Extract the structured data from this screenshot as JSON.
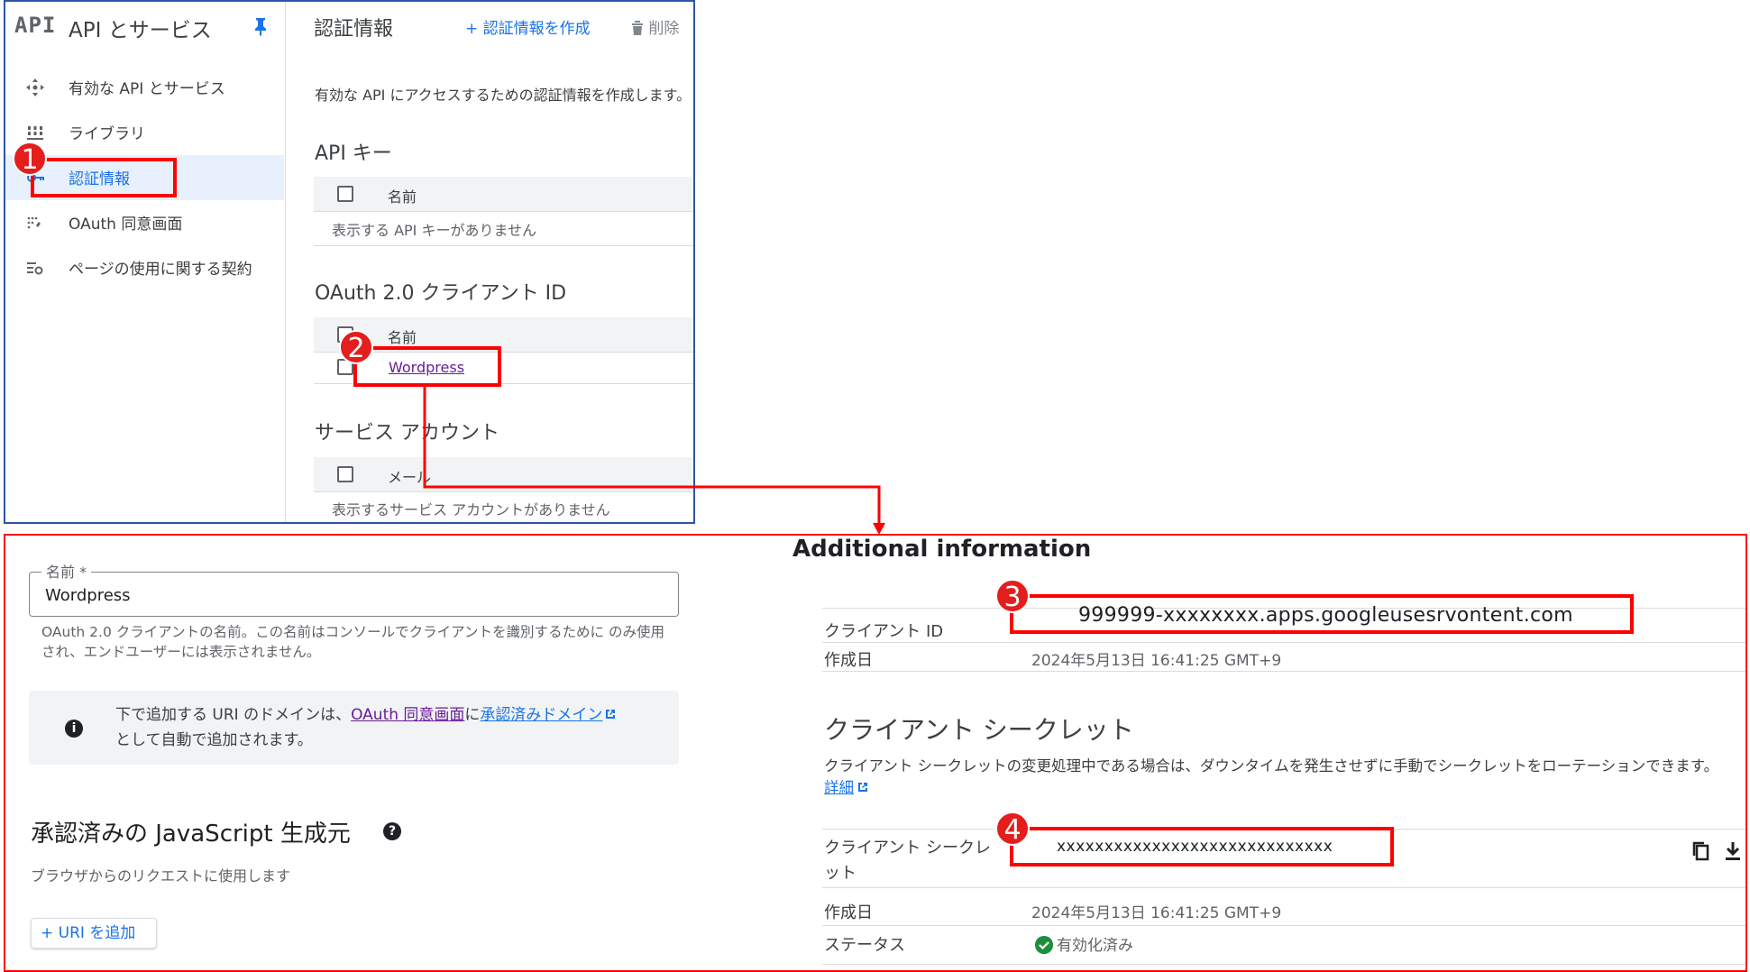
{
  "sidebar": {
    "logo": "API",
    "title": "API とサービス",
    "items": [
      {
        "label": "有効な API とサービス",
        "icon": "crosshair-icon"
      },
      {
        "label": "ライブラリ",
        "icon": "library-icon"
      },
      {
        "label": "認証情報",
        "icon": "key-icon",
        "active": true
      },
      {
        "label": "OAuth 同意画面",
        "icon": "consent-icon"
      },
      {
        "label": "ページの使用に関する契約",
        "icon": "settings-list-icon"
      }
    ]
  },
  "main": {
    "title": "認証情報",
    "create_label": "+ 認証情報を作成",
    "delete_label": "削除",
    "description": "有効な API にアクセスするための認証情報を作成します。",
    "api_keys": {
      "title": "API キー",
      "col_name": "名前",
      "empty": "表示する API キーがありません"
    },
    "oauth": {
      "title": "OAuth 2.0 クライアント ID",
      "col_name": "名前",
      "client": "Wordpress"
    },
    "service_accounts": {
      "title": "サービス アカウント",
      "col_email": "メール",
      "empty": "表示するサービス アカウントがありません"
    }
  },
  "annotations": {
    "badge1": "1",
    "badge2": "2",
    "badge3": "3",
    "badge4": "4",
    "color": "#ff0000"
  },
  "detail": {
    "name_label": "名前 *",
    "name_value": "Wordpress",
    "name_helper": "OAuth 2.0 クライアントの名前。この名前はコンソールでクライアントを識別するために のみ使用され、エンドユーザーには表示されません。",
    "info_prefix": "下で追加する URI のドメインは、",
    "info_link1": "OAuth 同意画面",
    "info_mid": "に",
    "info_link2": "承認済みドメイン",
    "info_suffix": "として自動で追加されます。",
    "js_title": "承認済みの JavaScript 生成元",
    "js_sub": "ブラウザからのリクエストに使用します",
    "add_uri": "+ URI を追加"
  },
  "additional": {
    "title": "Additional information",
    "client_id_label": "クライアント ID",
    "client_id_value": "999999-xxxxxxxx.apps.googleusesrvontent.com",
    "created_label": "作成日",
    "created_value": "2024年5月13日 16:41:25 GMT+9",
    "secret_title": "クライアント シークレット",
    "secret_desc": "クライアント シークレットの変更処理中である場合は、ダウンタイムを発生させずに手動でシークレットをローテーションできます。",
    "secret_more": "詳細",
    "secret_label_1": "クライアント シークレ",
    "secret_label_2": "ット",
    "secret_value": "xxxxxxxxxxxxxxxxxxxxxxxxxxxxx",
    "secret_created_label": "作成日",
    "secret_created_value": "2024年5月13日 16:41:25 GMT+9",
    "status_label": "ステータス",
    "status_value": "有効化済み"
  }
}
